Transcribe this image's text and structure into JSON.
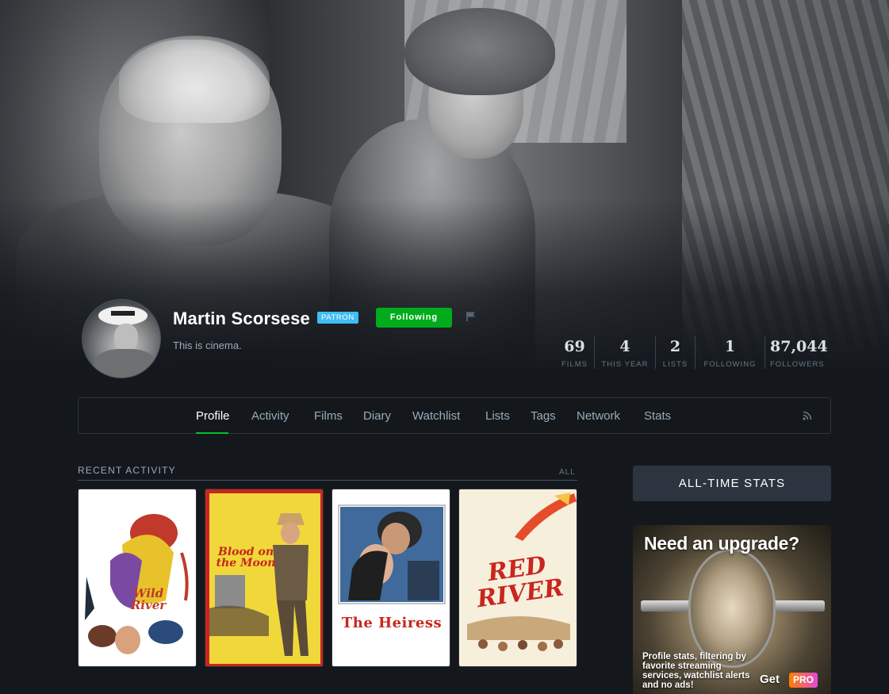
{
  "profile": {
    "name": "Martin Scorsese",
    "badge": "Patron",
    "follow_button": "Following",
    "bio": "This is cinema."
  },
  "stats": [
    {
      "value": "69",
      "label": "Films"
    },
    {
      "value": "4",
      "label": "This year"
    },
    {
      "value": "2",
      "label": "Lists"
    },
    {
      "value": "1",
      "label": "Following"
    },
    {
      "value": "87,044",
      "label": "Followers"
    }
  ],
  "nav": {
    "items": [
      "Profile",
      "Activity",
      "Films",
      "Diary",
      "Watchlist",
      "Lists",
      "Tags",
      "Network",
      "Stats"
    ],
    "active": "Profile"
  },
  "recent_activity": {
    "title": "Recent Activity",
    "all_link": "All",
    "posters": [
      {
        "title": "Wild River"
      },
      {
        "title": "Blood on the Moon"
      },
      {
        "title": "The Heiress"
      },
      {
        "title": "Red River"
      }
    ]
  },
  "sidebar": {
    "stats_button": "All-Time Stats",
    "ad": {
      "headline": "Need an upgrade?",
      "copy": "Profile stats, filtering by favorite streaming services, watchlist alerts and no ads!",
      "cta": "Get",
      "pro_badge": "PRO"
    }
  },
  "colors": {
    "background": "#14181c",
    "accent_green": "#00ac1c",
    "patron_blue": "#40bcf4",
    "nav_active_underline": "#00c030"
  },
  "icons": [
    "flag-icon",
    "rss-icon"
  ]
}
